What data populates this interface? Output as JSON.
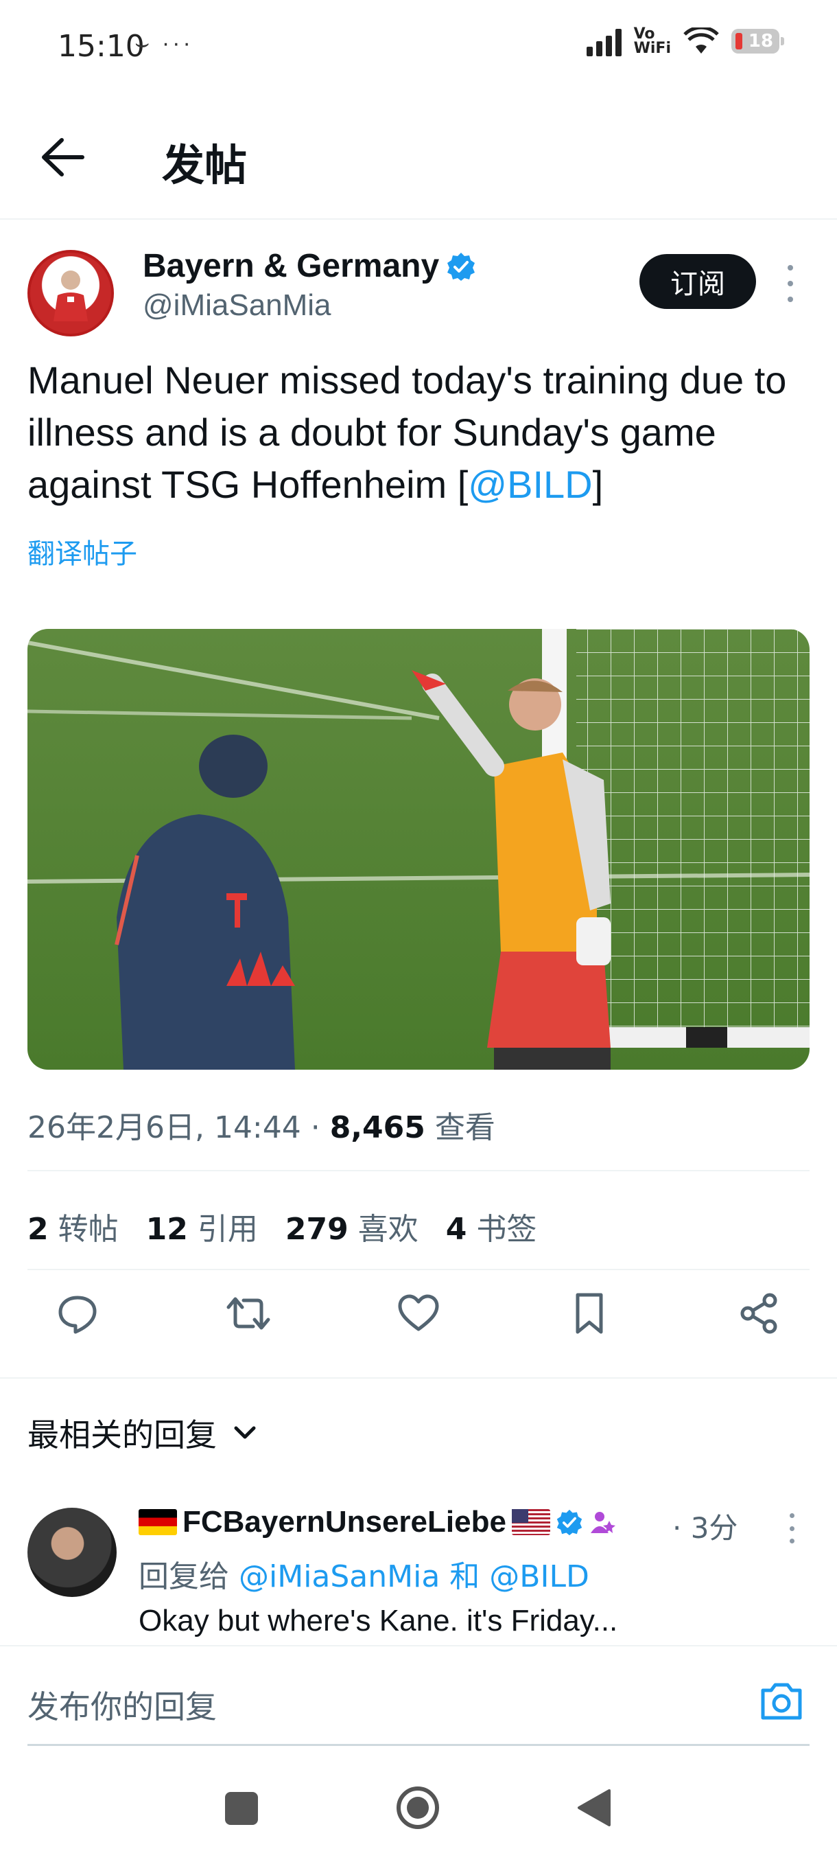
{
  "status_bar": {
    "time": "15:10",
    "extra": "⌣ ···",
    "vowifi_top": "Vo",
    "vowifi_bottom": "WiFi",
    "battery": "18"
  },
  "header": {
    "title": "发帖"
  },
  "tweet": {
    "author_name": "Bayern & Germany",
    "author_handle": "@iMiaSanMia",
    "subscribe_label": "订阅",
    "text_before": "Manuel Neuer missed today's training due to illness and is a doubt for Sunday's game against TSG Hoffenheim [",
    "mention": "@BILD",
    "text_after": "]",
    "translate_label": "翻译帖子",
    "timestamp": "26年2月6日, 14:44 · ",
    "views_count": "8,465",
    "views_label": " 查看",
    "stats": {
      "reposts_count": "2",
      "reposts_label": "转帖",
      "quotes_count": "12",
      "quotes_label": "引用",
      "likes_count": "279",
      "likes_label": "喜欢",
      "bookmarks_count": "4",
      "bookmarks_label": "书签"
    }
  },
  "replies": {
    "sort_label": "最相关的回复",
    "items": [
      {
        "author_name": "FCBayernUnsereLiebe",
        "time": "· 3分",
        "reply_to_prefix": "回复给 ",
        "reply_to": "@iMiaSanMia 和 @BILD",
        "text": "Okay but where's Kane. it's Friday..."
      }
    ]
  },
  "compose": {
    "placeholder": "发布你的回复"
  },
  "colors": {
    "accent": "#1d9bf0",
    "text": "#0f1419",
    "secondary": "#536471"
  }
}
